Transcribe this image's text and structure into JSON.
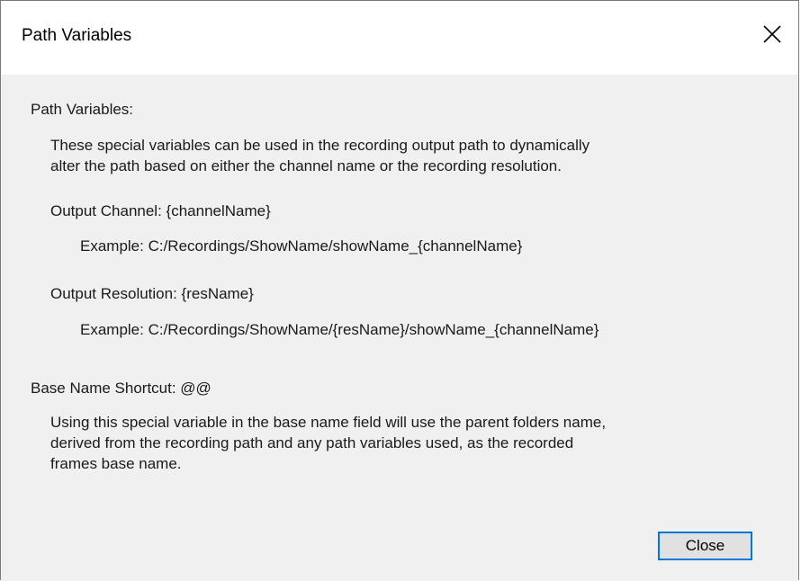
{
  "window": {
    "title": "Path Variables",
    "close_icon": "close-icon"
  },
  "content": {
    "path_variables_heading": "Path Variables:",
    "path_variables_desc_line1": "These special variables can be used in the recording output path to dynamically",
    "path_variables_desc_line2": "alter the path based on either the channel name or the recording resolution.",
    "output_channel_label": "Output Channel: {channelName}",
    "output_channel_example": "Example:  C:/Recordings/ShowName/showName_{channelName}",
    "output_resolution_label": "Output Resolution: {resName}",
    "output_resolution_example": "Example:  C:/Recordings/ShowName/{resName}/showName_{channelName}",
    "base_name_heading": "Base Name Shortcut: @@",
    "base_name_desc_line1": "Using this special variable in the base name field will use the parent folders name,",
    "base_name_desc_line2": "derived from the recording path and any path variables used, as the recorded",
    "base_name_desc_line3": "frames base name."
  },
  "buttons": {
    "close_label": "Close"
  },
  "colors": {
    "client_bg": "#f0f0f0",
    "button_accent": "#0078d7"
  }
}
